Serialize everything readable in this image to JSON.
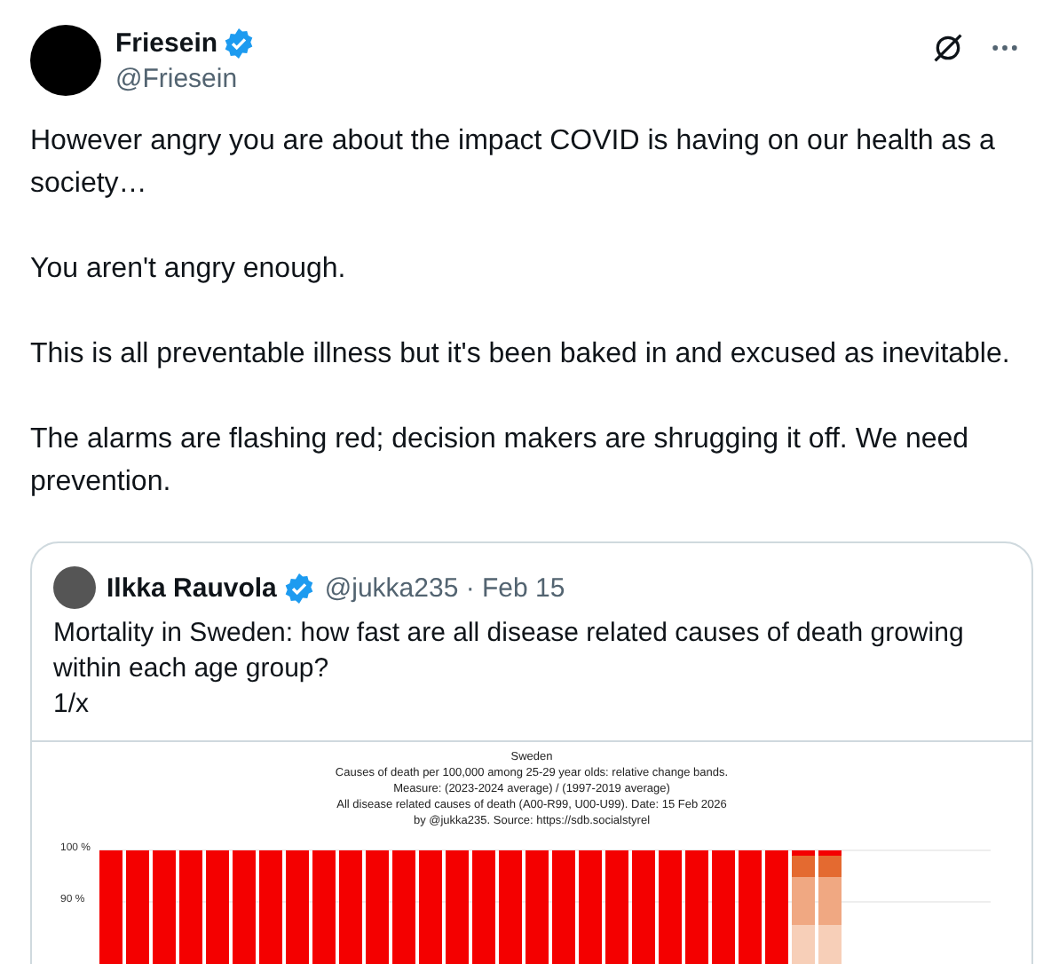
{
  "author": {
    "name": "Friesein",
    "handle": "@Friesein",
    "verified": true
  },
  "paragraphs": [
    "However angry you are about the impact COVID is having on our health as a society…",
    "You aren't angry enough.",
    "This is all preventable illness but it's been baked in and excused as inevitable.",
    "The alarms are flashing red; decision makers are shrugging it off. We need prevention."
  ],
  "quote": {
    "author": {
      "name": "Ilkka Rauvola",
      "verified": true,
      "meta": "@jukka235 · Feb 15"
    },
    "text": "Mortality in Sweden: how fast are all disease related causes of death growing within each age group?\n1/x",
    "image": {
      "title_lines": [
        "Sweden",
        "Causes of death per 100,000 among  25-29 year olds: relative change bands.",
        "Measure: (2023-2024 average) / (1997-2019 average)",
        "All disease related causes of death (A00-R99, U00-U99).   Date: 15 Feb 2026",
        "by @jukka235. Source: https://sdb.socialstyrel"
      ],
      "y_tick_labels": [
        "100 %",
        "90 %"
      ]
    }
  }
}
